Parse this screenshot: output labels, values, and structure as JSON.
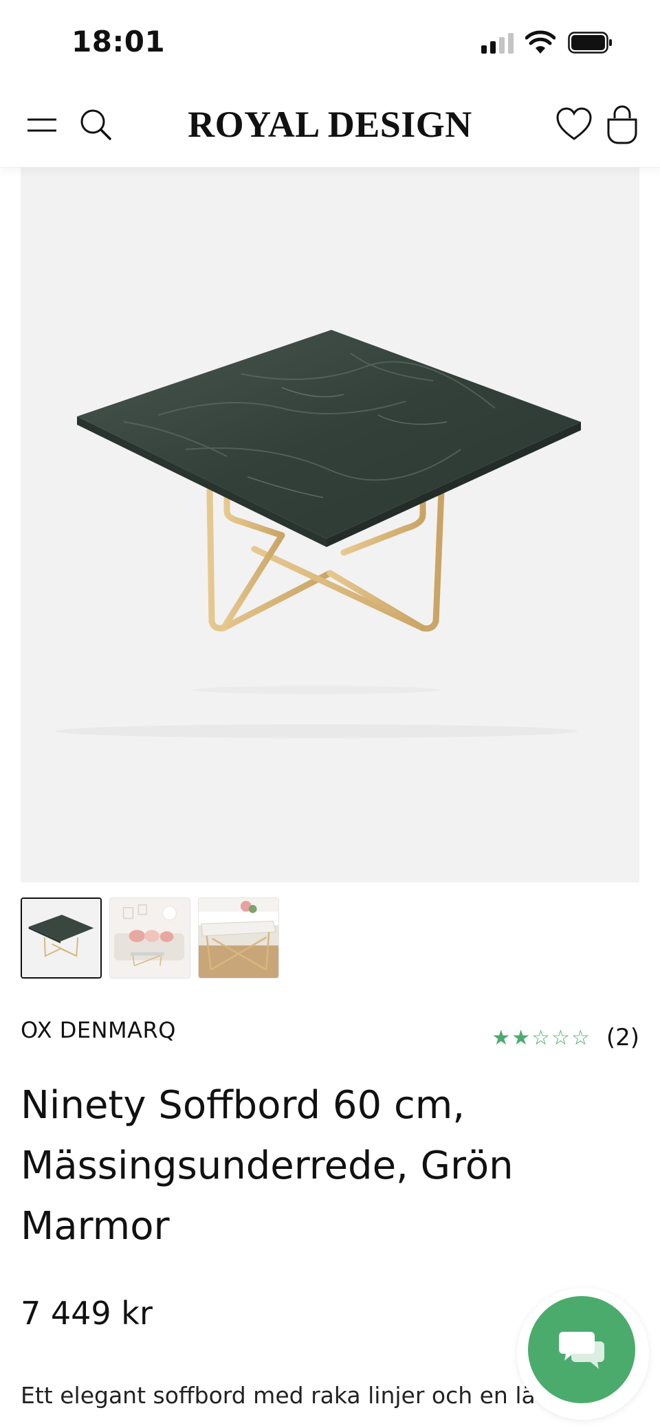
{
  "status_bar": {
    "time": "18:01"
  },
  "header": {
    "logo": "ROYAL DESIGN"
  },
  "product": {
    "brand": "OX DENMARQ",
    "rating": {
      "stars_filled": 2,
      "stars_total": 5,
      "stars_display": "★★☆☆☆",
      "review_count": "(2)"
    },
    "title": "Ninety Soffbord 60 cm, Mässingsunderrede, Grön Marmor",
    "price": "7 449 kr",
    "description": "Ett elegant soffbord med raka linjer och en lätt ... ett."
  },
  "gallery": {
    "thumbnails": [
      "thumbnail-1",
      "thumbnail-2",
      "thumbnail-3"
    ],
    "active_index": 0
  },
  "icons": {
    "menu": "menu-icon",
    "search": "search-icon",
    "wishlist": "heart-icon",
    "cart": "bag-icon",
    "chat": "chat-icon"
  },
  "colors": {
    "accent_green": "#4bab6d",
    "marble": "#3d4a44",
    "brass": "#d8b77d",
    "image_background": "#f2f2f2"
  }
}
